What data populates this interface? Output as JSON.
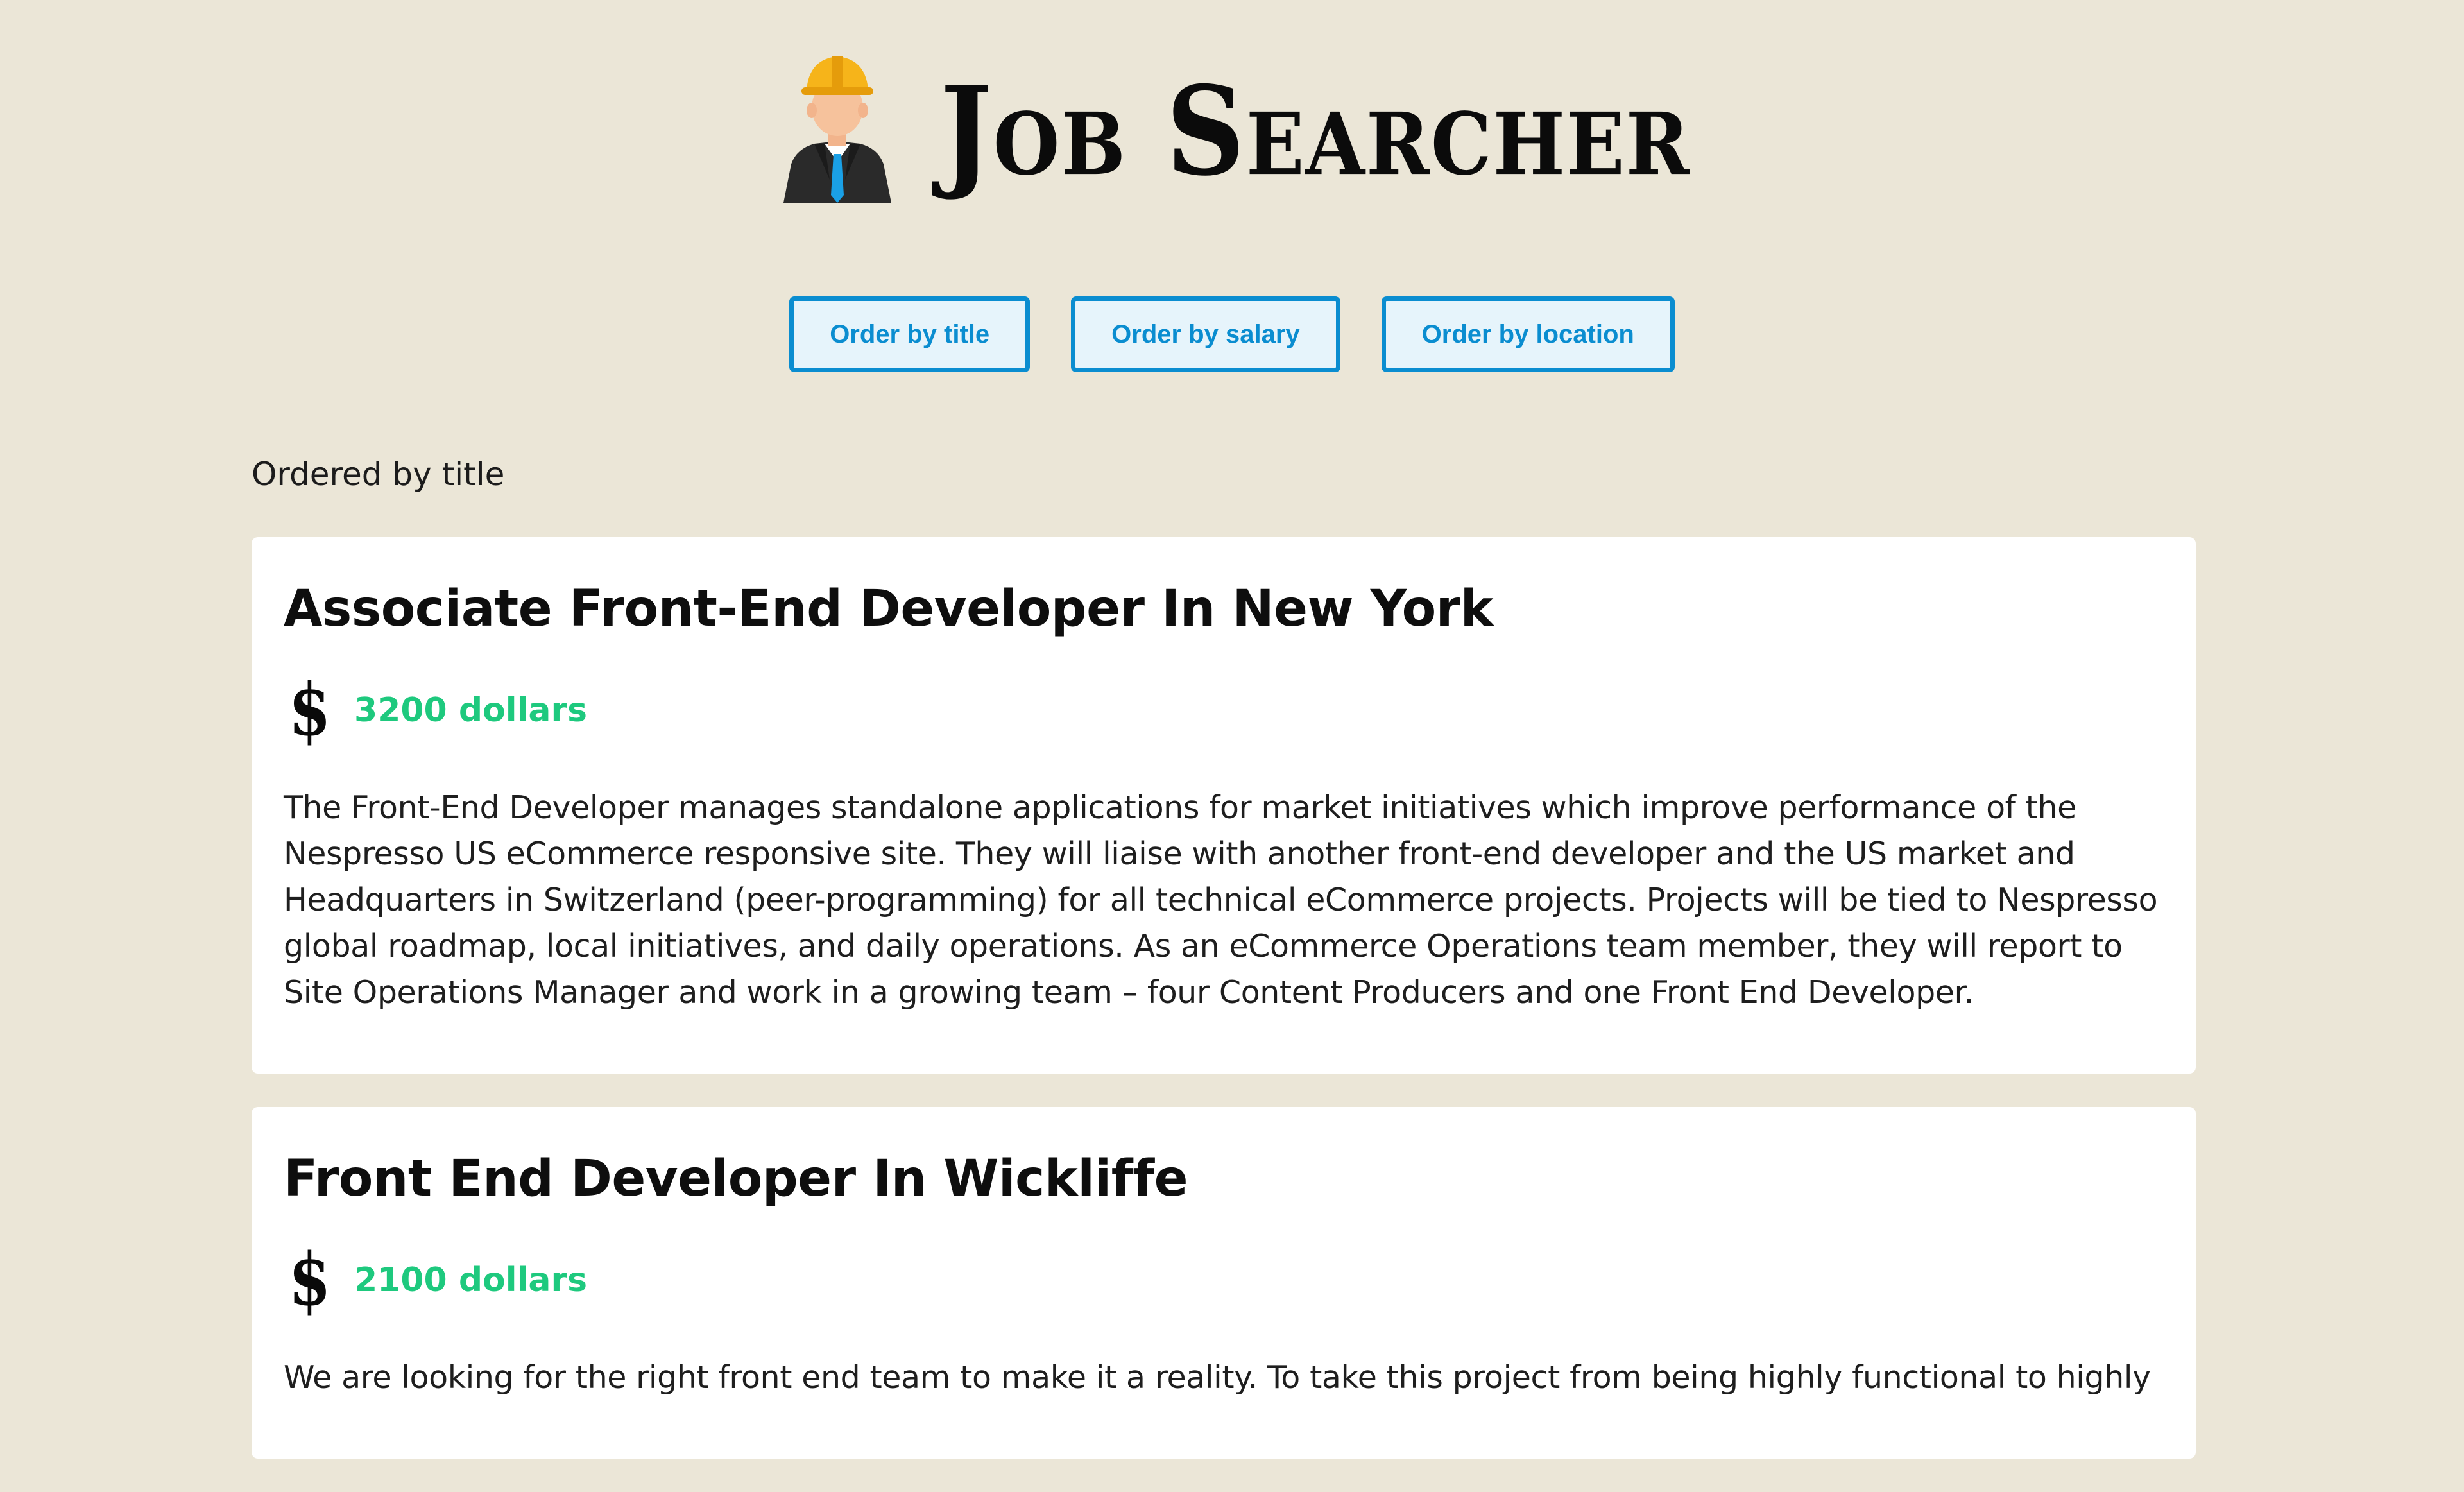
{
  "header": {
    "logo_icon": "construction-worker-hardhat-icon",
    "title": "Job Searcher"
  },
  "controls": {
    "order_title": "Order by title",
    "order_salary": "Order by salary",
    "order_location": "Order by location"
  },
  "ordered_label": "Ordered by title",
  "colors": {
    "background": "#ebe6d7",
    "button_border": "#0a8dd0",
    "button_fill": "#e6f4fb",
    "salary": "#1ec97e"
  },
  "jobs": [
    {
      "title": "Associate Front-End Developer In New York",
      "salary_icon": "dollar-icon",
      "salary": "3200 dollars",
      "description": "The Front-End Developer manages standalone applications for market initiatives which improve performance of the Nespresso US eCommerce responsive site. They will liaise with another front-end developer and the US market and Headquarters in Switzerland (peer-programming) for all technical eCommerce projects. Projects will be tied to Nespresso global roadmap, local initiatives, and daily operations. As an eCommerce Operations team member, they will report to Site Operations Manager and work in a growing team – four Content Producers and one Front End Developer."
    },
    {
      "title": "Front End Developer In Wickliffe",
      "salary_icon": "dollar-icon",
      "salary": "2100 dollars",
      "description": "We are looking for the right front end team to make it a reality. To take this project from being highly functional to highly"
    }
  ]
}
